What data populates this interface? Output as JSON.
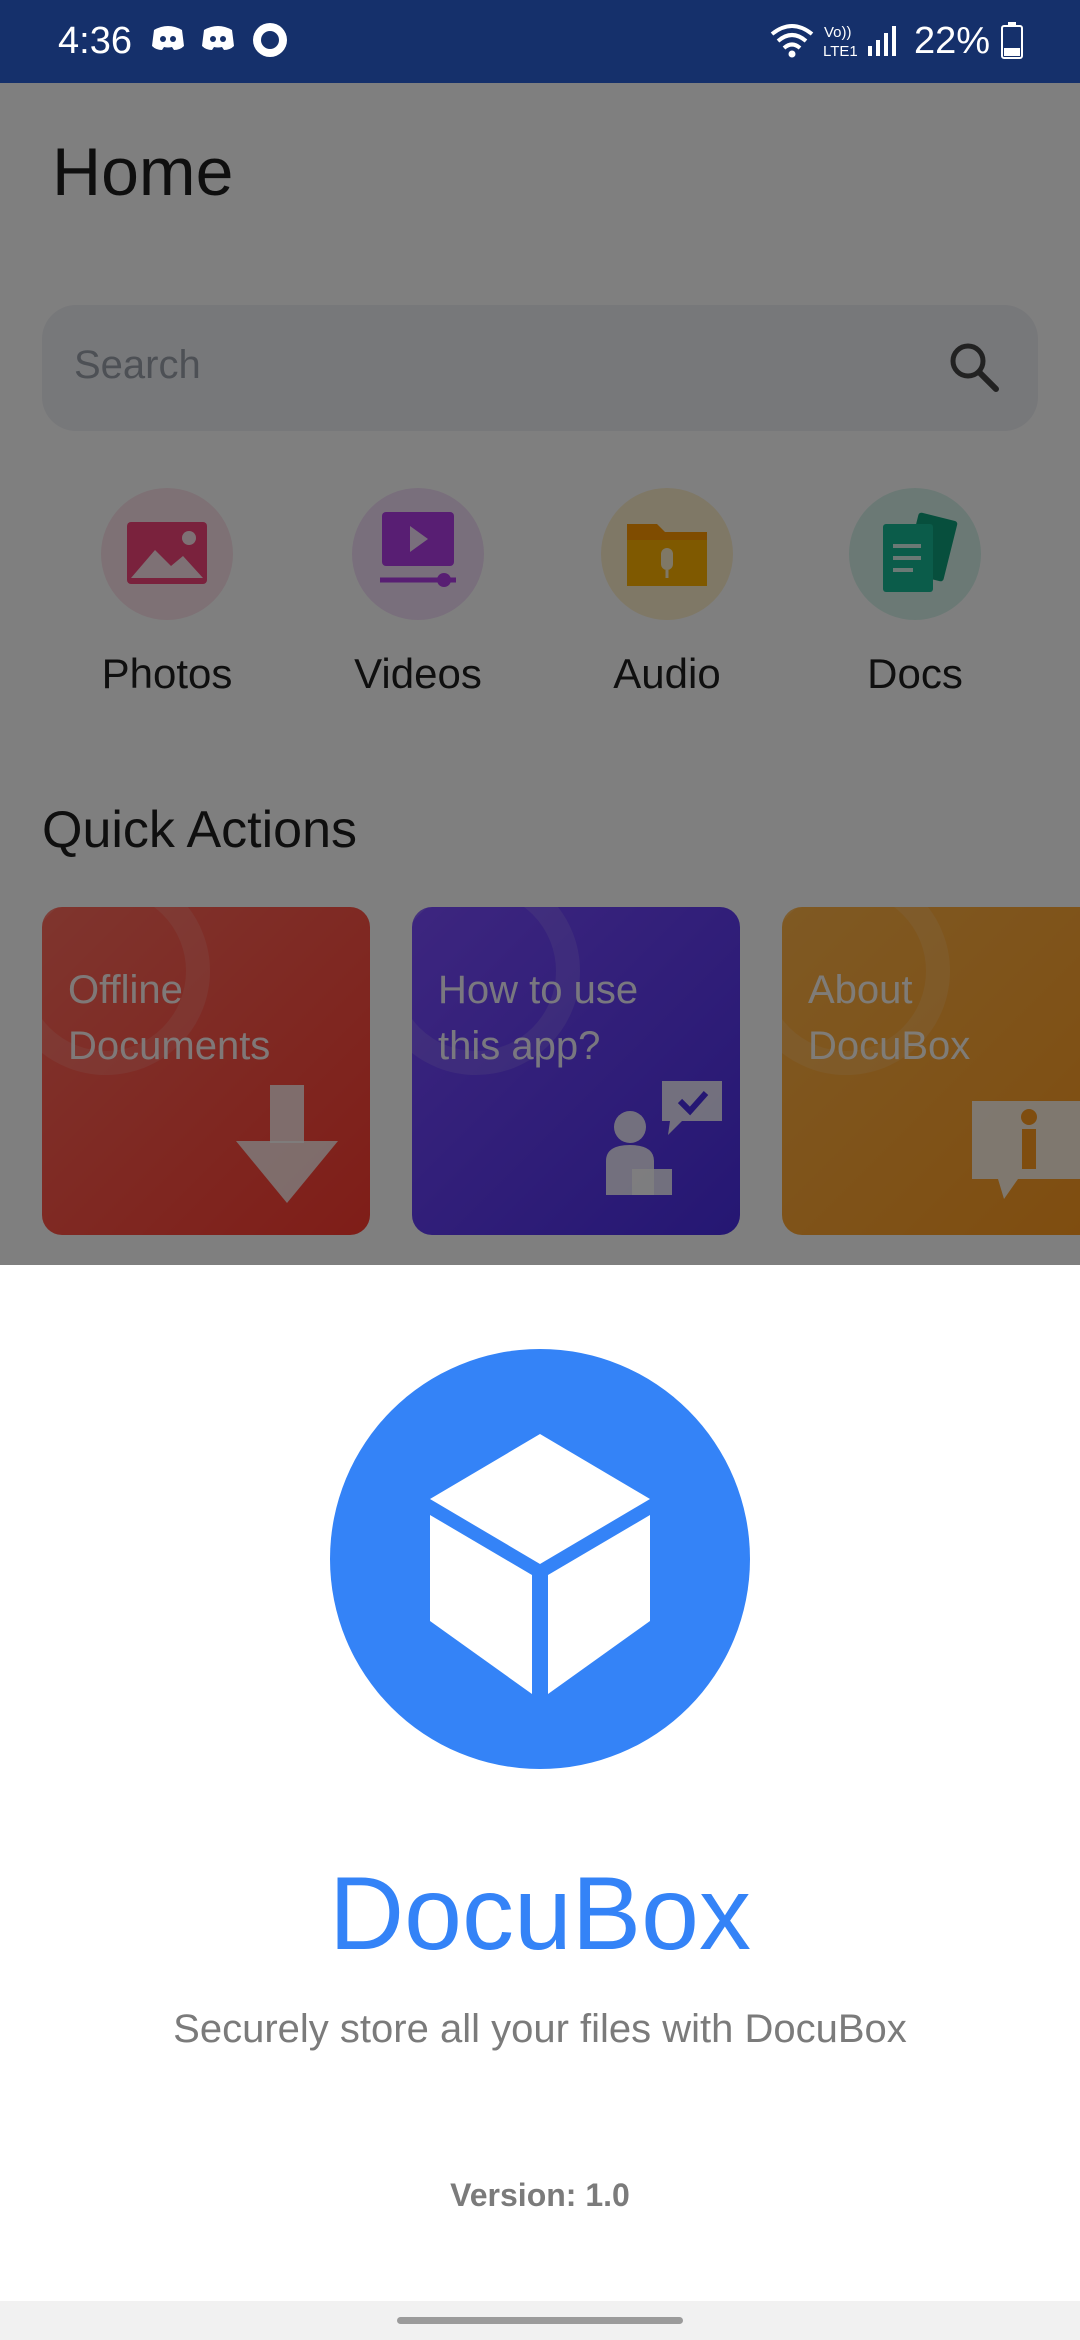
{
  "status_bar": {
    "time": "4:36",
    "battery": "22%",
    "network_label": "Vo)) LTE1",
    "icons": [
      "discord-icon",
      "discord-icon",
      "circle-app-icon",
      "wifi-icon",
      "lte-icon",
      "signal-icon",
      "battery-icon"
    ]
  },
  "home": {
    "title": "Home",
    "search_placeholder": "Search",
    "categories": [
      {
        "label": "Photos",
        "icon": "photo-icon",
        "color": "#f5457a"
      },
      {
        "label": "Videos",
        "icon": "video-icon",
        "color": "#b03de7"
      },
      {
        "label": "Audio",
        "icon": "audio-folder-icon",
        "color": "#ff9800"
      },
      {
        "label": "Docs",
        "icon": "docs-icon",
        "color": "#16b894"
      }
    ],
    "quick_actions_title": "Quick Actions",
    "quick_actions": [
      {
        "line1": "Offline",
        "line2": "Documents",
        "icon": "download-arrow-icon",
        "color": "#ff4a3d"
      },
      {
        "line1": "How to use",
        "line2": "this app?",
        "icon": "help-chat-icon",
        "color": "#5b3cf2"
      },
      {
        "line1": "About",
        "line2": "DocuBox",
        "icon": "info-icon",
        "color": "#ffa12b"
      }
    ]
  },
  "about_sheet": {
    "app_name": "DocuBox",
    "tagline": "Securely store all your files with DocuBox",
    "version": "Version: 1.0",
    "accent": "#3483f7"
  }
}
